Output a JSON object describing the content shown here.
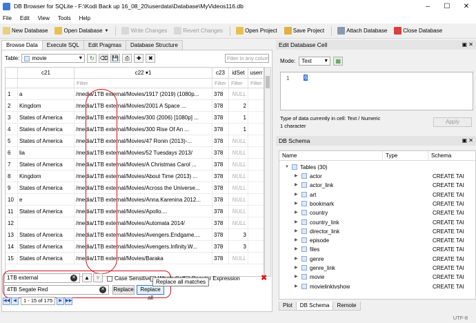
{
  "window": {
    "title": "DB Browser for SQLite - F:\\Kodi Back up 16_08_20\\userdata\\Database\\MyVideos116.db"
  },
  "menu": [
    "File",
    "Edit",
    "View",
    "Tools",
    "Help"
  ],
  "toolbar": {
    "new_db": "New Database",
    "open_db": "Open Database",
    "write_changes": "Write Changes",
    "revert_changes": "Revert Changes",
    "open_project": "Open Project",
    "save_project": "Save Project",
    "attach_db": "Attach Database",
    "close_db": "Close Database"
  },
  "tabs": [
    "Browse Data",
    "Execute SQL",
    "Edit Pragmas",
    "Database Structure"
  ],
  "browse": {
    "table_label": "Table:",
    "table_value": "movie",
    "filter_all_placeholder": "Filter in any column",
    "columns": [
      "c21",
      "c22 ▾1",
      "c23",
      "idSet",
      "userr"
    ],
    "filter_placeholder": "Filter",
    "rows": [
      {
        "n": "1",
        "c21": "a",
        "c22": "/media/1TB external/Movies/1917 (2019) (1080p...",
        "c23": "378",
        "idSet": "NULL"
      },
      {
        "n": "2",
        "c21": "Kingdom",
        "c22": "/media/1TB external/Movies/2001 A Space ...",
        "c23": "378",
        "idSet": "2"
      },
      {
        "n": "3",
        "c21": "States of America",
        "c22": "/media/1TB external/Movies/300 (2006) [1080p] ...",
        "c23": "378",
        "idSet": "1"
      },
      {
        "n": "4",
        "c21": "States of America",
        "c22": "/media/1TB external/Movies/300 Rise Of An ...",
        "c23": "378",
        "idSet": "1"
      },
      {
        "n": "5",
        "c21": "States of America",
        "c22": "/media/1TB external/Movies/47 Ronin (2013)-...",
        "c23": "378",
        "idSet": "NULL"
      },
      {
        "n": "6",
        "c21": "lia",
        "c22": "/media/1TB external/Movies/52 Tuesdays 2013/",
        "c23": "378",
        "idSet": "NULL"
      },
      {
        "n": "7",
        "c21": "States of America",
        "c22": "/media/1TB external/Movies/A Christmas Carol ...",
        "c23": "378",
        "idSet": "NULL"
      },
      {
        "n": "8",
        "c21": "Kingdom",
        "c22": "/media/1TB external/Movies/About Time (2013) ...",
        "c23": "378",
        "idSet": "NULL"
      },
      {
        "n": "9",
        "c21": "States of America",
        "c22": "/media/1TB external/Movies/Across the Universe...",
        "c23": "378",
        "idSet": "NULL"
      },
      {
        "n": "10",
        "c21": "e",
        "c22": "/media/1TB external/Movies/Anna.Karenina 2012...",
        "c23": "378",
        "idSet": "NULL"
      },
      {
        "n": "11",
        "c21": "States of America",
        "c22": "/media/1TB external/Movies/Apollo....",
        "c23": "378",
        "idSet": "NULL"
      },
      {
        "n": "12",
        "c21": "",
        "c22": "/media/1TB external/Movies/Automata 2014/",
        "c23": "378",
        "idSet": "NULL"
      },
      {
        "n": "13",
        "c21": "States of America",
        "c22": "/media/1TB external/Movies/Avengers.Endgame....",
        "c23": "378",
        "idSet": "3"
      },
      {
        "n": "14",
        "c21": "States of America",
        "c22": "/media/1TB external/Movies/Avengers.Infinity.W...",
        "c23": "378",
        "idSet": "3"
      },
      {
        "n": "15",
        "c21": "States of America",
        "c22": "/media/1TB external/Movies/Baraka",
        "c23": "378",
        "idSet": "NULL"
      }
    ]
  },
  "find": {
    "find_value": "1TB external",
    "replace_value": "4TB Segate Red",
    "case_sensitive": "Case Sensitive",
    "whole_cell": "Whole Cell",
    "regex": "Regular Expression",
    "replace": "Replace",
    "replace_all": "Replace all",
    "tooltip": "Replace all matches"
  },
  "pager": {
    "text": "1 - 15 of 175"
  },
  "edit_cell": {
    "title": "Edit Database Cell",
    "mode_label": "Mode:",
    "mode_value": "Text",
    "line_no": "1",
    "value": "6",
    "type_info": "Type of data currently in cell: Text / Numeric",
    "size_info": "1 character",
    "apply": "Apply"
  },
  "schema": {
    "title": "DB Schema",
    "headers": [
      "Name",
      "Type",
      "Schema"
    ],
    "root": "Tables (30)",
    "items": [
      "actor",
      "actor_link",
      "art",
      "bookmark",
      "country",
      "country_link",
      "director_link",
      "episode",
      "files",
      "genre",
      "genre_link",
      "movie",
      "movielinktvshow"
    ],
    "schema_value": "CREATE TAI"
  },
  "bottom_tabs": [
    "Plot",
    "DB Schema",
    "Remote"
  ],
  "status": {
    "encoding": "UTF-8"
  },
  "colors": {
    "annotation": "#cc1020",
    "selection": "#3070d8"
  }
}
